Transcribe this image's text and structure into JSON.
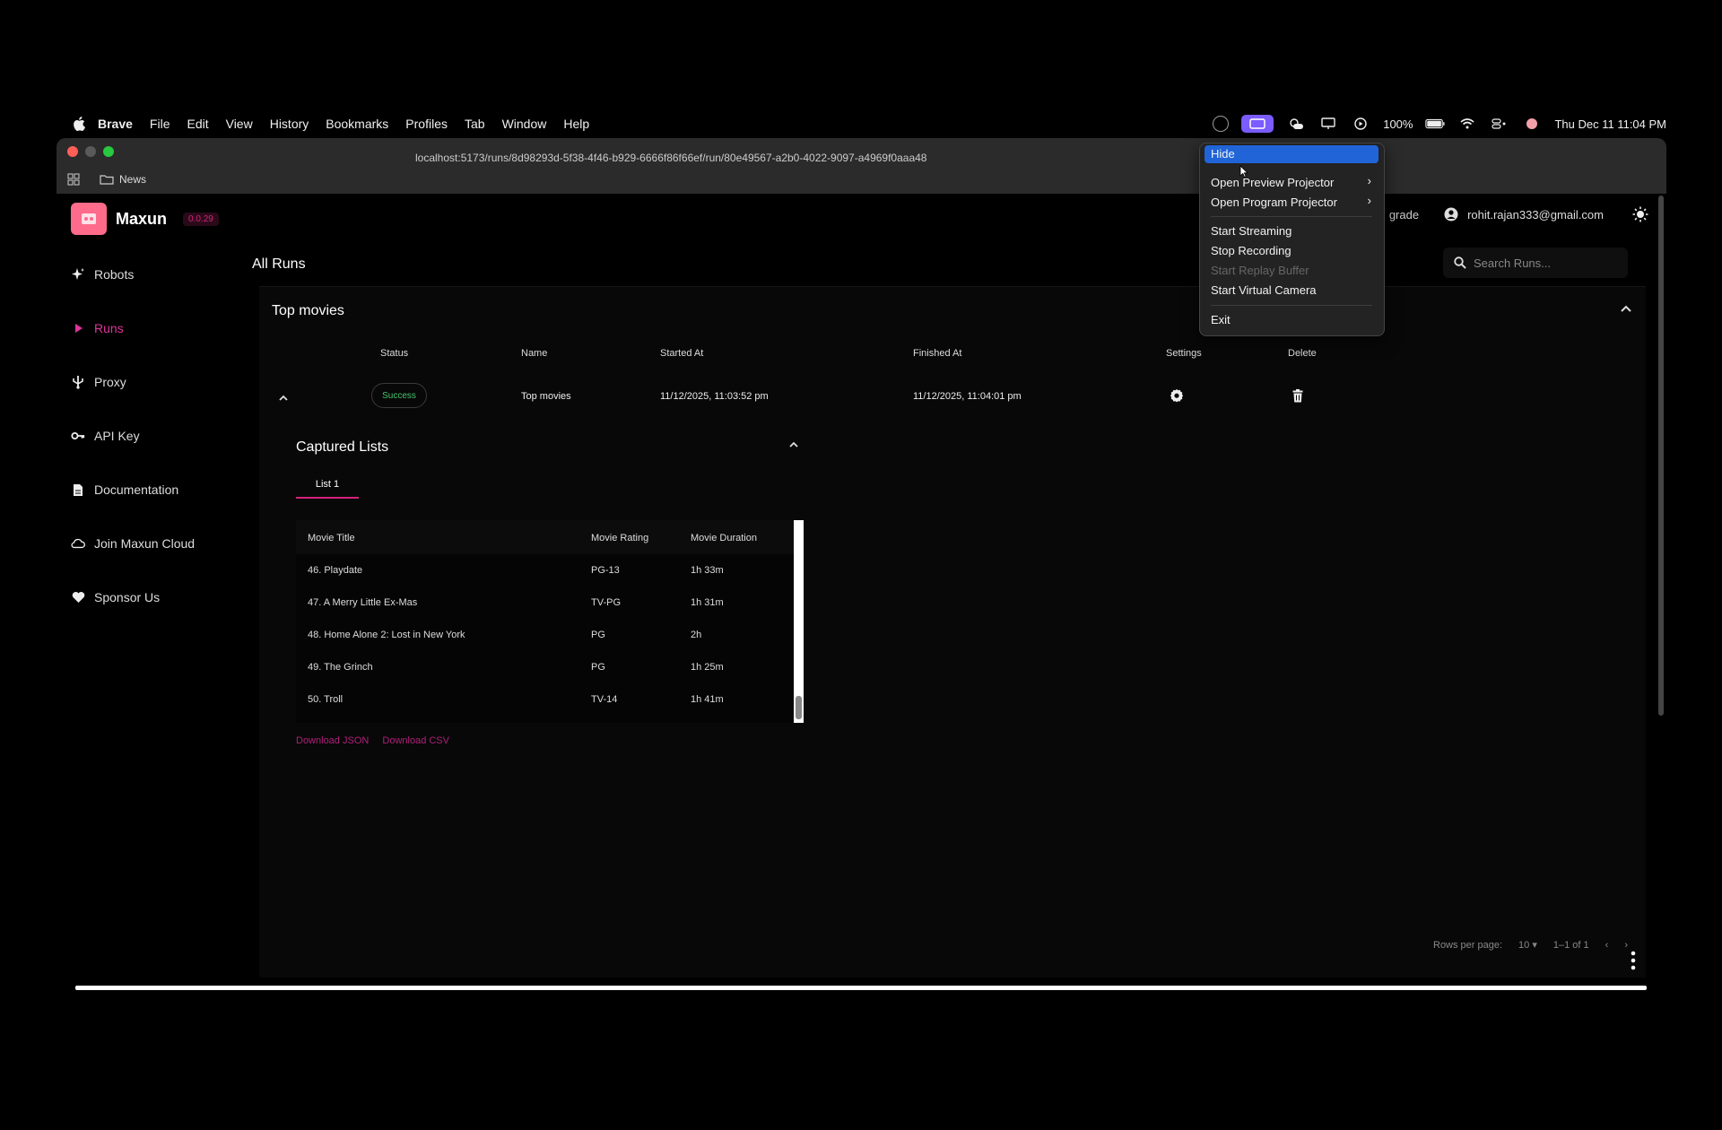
{
  "menubar": {
    "items": [
      "Brave",
      "File",
      "Edit",
      "View",
      "History",
      "Bookmarks",
      "Profiles",
      "Tab",
      "Window",
      "Help"
    ],
    "battery": "100%",
    "clock": "Thu Dec 11  11:04 PM"
  },
  "browser": {
    "url": "localhost:5173/runs/8d98293d-5f38-4f46-b929-6666f86f66ef/run/80e49567-a2b0-4022-9097-a4969f0aaa48",
    "bookmark_folder": "News"
  },
  "app": {
    "name": "Maxun",
    "version": "0.0.29",
    "upgrade_label": "grade",
    "user_email": "rohit.rajan333@gmail.com"
  },
  "sidebar": {
    "items": [
      {
        "label": "Robots",
        "icon": "sparkle-icon"
      },
      {
        "label": "Runs",
        "icon": "play-icon"
      },
      {
        "label": "Proxy",
        "icon": "usb-icon"
      },
      {
        "label": "API Key",
        "icon": "key-icon"
      },
      {
        "label": "Documentation",
        "icon": "document-icon"
      },
      {
        "label": "Join Maxun Cloud",
        "icon": "cloud-icon"
      },
      {
        "label": "Sponsor Us",
        "icon": "heart-icon"
      }
    ],
    "active_index": 1
  },
  "main": {
    "title": "All Runs",
    "search_placeholder": "Search Runs...",
    "group_title": "Top movies",
    "columns": [
      "Status",
      "Name",
      "Started At",
      "Finished At",
      "Settings",
      "Delete"
    ],
    "run": {
      "status": "Success",
      "name": "Top movies",
      "started_at": "11/12/2025, 11:03:52 pm",
      "finished_at": "11/12/2025, 11:04:01 pm"
    },
    "captured": {
      "title": "Captured Lists",
      "tab": "List 1",
      "headers": [
        "Movie Title",
        "Movie Rating",
        "Movie Duration"
      ],
      "rows": [
        [
          "46. Playdate",
          "PG-13",
          "1h 33m"
        ],
        [
          "47. A Merry Little Ex-Mas",
          "TV-PG",
          "1h 31m"
        ],
        [
          "48. Home Alone 2: Lost in New York",
          "PG",
          "2h"
        ],
        [
          "49. The Grinch",
          "PG",
          "1h 25m"
        ],
        [
          "50. Troll",
          "TV-14",
          "1h 41m"
        ]
      ],
      "download_json": "Download JSON",
      "download_csv": "Download CSV"
    },
    "pagination": {
      "rows_per_page_label": "Rows per page:",
      "rows_per_page_value": "10",
      "range": "1–1 of 1"
    }
  },
  "context_menu": {
    "items": [
      {
        "label": "Hide",
        "highlighted": true
      },
      {
        "label": "Open Preview Projector",
        "submenu": true
      },
      {
        "label": "Open Program Projector",
        "submenu": true
      },
      {
        "label": "Start Streaming"
      },
      {
        "label": "Stop Recording"
      },
      {
        "label": "Start Replay Buffer",
        "disabled": true
      },
      {
        "label": "Start Virtual Camera"
      },
      {
        "label": "Exit"
      }
    ]
  },
  "colors": {
    "accent": "#d4227b",
    "success": "#46c46a",
    "menu_highlight": "#2064d8"
  }
}
